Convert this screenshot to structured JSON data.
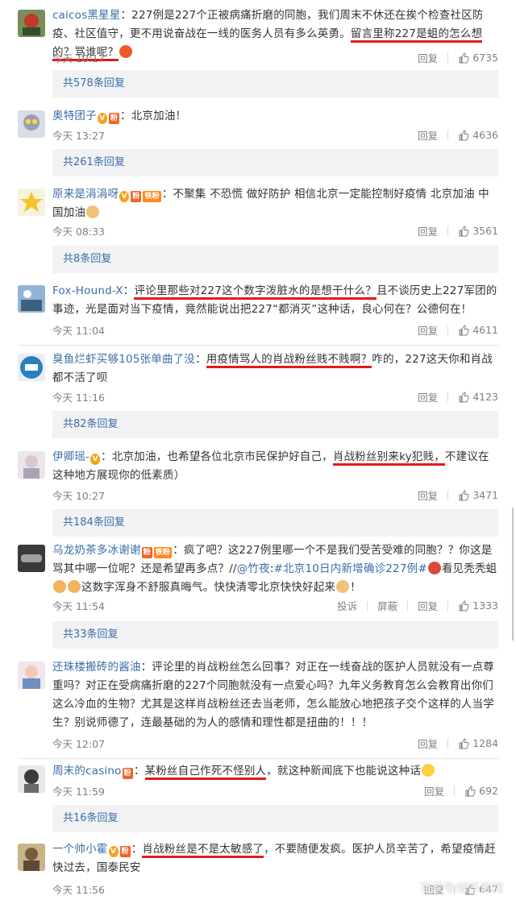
{
  "comments": [
    {
      "user": "caicos黑星星",
      "badges": [],
      "segments": [
        {
          "t": "：227例是227个正被病痛折磨的同胞，我们周末不休还在挨个检查社区防疫、社区值守，更不用说奋战在一线的医务人员有多么英勇。"
        },
        {
          "t": "留言里称227是蛆的怎么想的？骂谁呢？",
          "hl": true
        },
        {
          "emoji": "angry-face-emoji"
        }
      ],
      "time": "今天 10:17",
      "reply": "回复",
      "likes": "6735",
      "replies_text": "共578条回复"
    },
    {
      "user": "奥特团子",
      "badges": [
        "V",
        "fan"
      ],
      "segments": [
        {
          "t": "：北京加油！"
        }
      ],
      "time": "今天 13:27",
      "reply": "回复",
      "likes": "4636",
      "replies_text": "共261条回复"
    },
    {
      "user": "原来是涓涓呀",
      "badges": [
        "V",
        "fan",
        "铁粉"
      ],
      "segments": [
        {
          "t": "：不聚集 不恐慌 做好防护 相信北京一定能控制好疫情 北京加油 中国加油"
        },
        {
          "emoji": "strong-arm-emoji"
        }
      ],
      "time": "今天 08:33",
      "reply": "回复",
      "likes": "3561",
      "replies_text": "共8条回复"
    },
    {
      "user": "Fox-Hound-X",
      "badges": [],
      "segments": [
        {
          "t": "："
        },
        {
          "t": "评论里那些对227这个数字泼脏水的是想干什么？",
          "hl": true
        },
        {
          "t": "且不谈历史上227军团的事迹，光是面对当下疫情，竟然能说出把227“都消灭”这种话，良心何在？公德何在！"
        }
      ],
      "time": "今天 11:04",
      "reply": "回复",
      "likes": "4611",
      "replies_text": ""
    },
    {
      "user": "臭鱼烂虾买够105张单曲了没",
      "badges": [],
      "segments": [
        {
          "t": "："
        },
        {
          "t": "用疫情骂人的肖战粉丝贱不贱啊？",
          "hl": true
        },
        {
          "t": "咋的，227这天你和肖战都不活了呗"
        }
      ],
      "time": "今天 11:16",
      "reply": "回复",
      "likes": "4123",
      "replies_text": "共82条回复"
    },
    {
      "user": "伊卿瑶-",
      "badges": [
        "V"
      ],
      "segments": [
        {
          "t": "：北京加油，也希望各位北京市民保护好自己，"
        },
        {
          "t": "肖战粉丝别来ky犯贱，",
          "hl": true
        },
        {
          "t": "不建议在这种地方展现你的低素质）"
        }
      ],
      "time": "今天 10:27",
      "reply": "回复",
      "likes": "3471",
      "replies_text": "共184条回复"
    },
    {
      "user": "乌龙奶茶多冰谢谢",
      "badges": [
        "fan",
        "铁粉"
      ],
      "segments": [
        {
          "t": "：疯了吧？这227例里哪一个不是我们受苦受难的同胞？？你这是骂其中哪一位呢？还是希望再多点？//"
        },
        {
          "t": "@竹夜",
          "link": true
        },
        {
          "t": ":"
        },
        {
          "t": "#北京10日内新增确诊227例#",
          "link": true
        },
        {
          "emoji": "sad-face-emoji"
        },
        {
          "t": "看见秃秃蛆"
        },
        {
          "emoji": "thumbs-down-emoji"
        },
        {
          "emoji": "thumbs-down-emoji"
        },
        {
          "t": "这数字浑身不舒服真晦气。快快清零北京快快好起来"
        },
        {
          "emoji": "strong-arm-emoji"
        },
        {
          "t": "！"
        }
      ],
      "time": "今天 11:54",
      "report": "投诉",
      "block": "屏蔽",
      "reply": "回复",
      "likes": "1333",
      "replies_text": "共33条回复"
    },
    {
      "user": "还珠楼搬砖的酱油",
      "badges": [],
      "segments": [
        {
          "t": "：评论里的肖战粉丝怎么回事？对正在一线奋战的医护人员就没有一点尊重吗？对正在受病痛折磨的227个同胞就没有一点爱心吗？九年义务教育怎么会教育出你们这么冷血的生物？尤其是这样肖战粉丝还去当老师，怎么能放心地把孩子交个这样的人当学生？别说师德了，连最基础的为人的感情和理性都是扭曲的！！！"
        }
      ],
      "time": "今天 12:07",
      "reply": "回复",
      "likes": "1284",
      "replies_text": ""
    },
    {
      "user": "周末的casino",
      "badges": [
        "fan"
      ],
      "segments": [
        {
          "t": "："
        },
        {
          "t": "某粉丝自己作死不怪别人",
          "hl": true
        },
        {
          "t": "，就这种新闻底下也能说这种话"
        },
        {
          "emoji": "sweat-smile-emoji"
        }
      ],
      "time": "今天 11:59",
      "reply": "回复",
      "likes": "692",
      "replies_text": "共16条回复"
    },
    {
      "user": "一个帅小霍",
      "badges": [
        "V",
        "fan"
      ],
      "segments": [
        {
          "t": "："
        },
        {
          "t": "肖战粉丝是不是太敏感了",
          "hl": true
        },
        {
          "t": "，不要随便发疯。医护人员辛苦了，希望疫情赶快过去，国泰民安"
        }
      ],
      "time": "今天 11:56",
      "reply": "回复",
      "likes": "647",
      "replies_text": ""
    }
  ],
  "badge_labels": {
    "V": "V",
    "fan": "粉"
  },
  "watermark": "百家号/娱乐频视",
  "colors": {
    "link": "#3c6da8",
    "highlight": "#e21b1b",
    "reply_bg": "#f2f2f5",
    "meta": "#808080"
  }
}
